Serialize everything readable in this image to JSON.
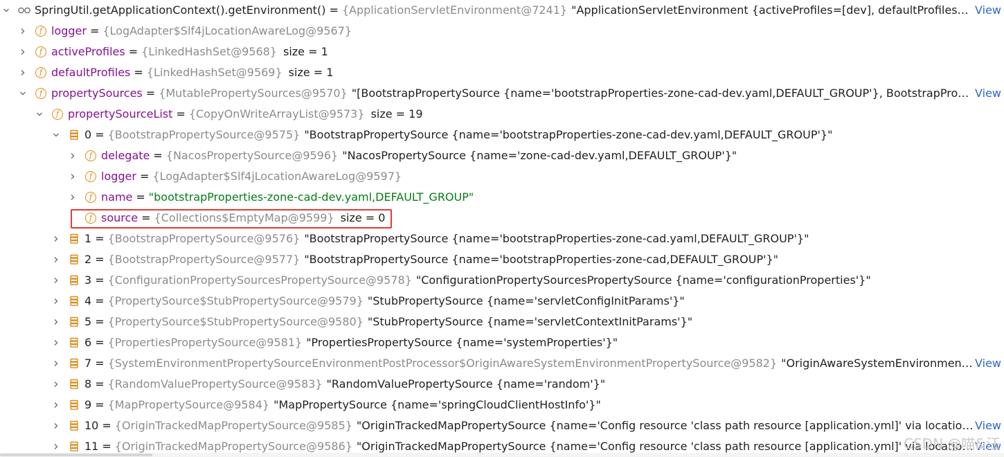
{
  "rows": [
    {
      "depth": 0,
      "chev": "down",
      "icon": "watch",
      "name": "SpringUtil.getApplicationContext().getEnvironment()",
      "name_color": "black",
      "ref": "{ApplicationServletEnvironment@7241}",
      "val": "\"ApplicationServletEnvironment {activeProfiles=[dev], defaultProfiles=[default], propertySources=[BootstrapPropertySource {name='bootstrapProperties-zone-cad-dev.yaml,DEFAULT_GROUP'}]}\"",
      "view": "View"
    },
    {
      "depth": 1,
      "chev": "right",
      "icon": "field",
      "name": "logger",
      "ref": "{LogAdapter$Slf4jLocationAwareLog@9567}"
    },
    {
      "depth": 1,
      "chev": "right",
      "icon": "field",
      "name": "activeProfiles",
      "ref": "{LinkedHashSet@9568}",
      "size": "size = 1"
    },
    {
      "depth": 1,
      "chev": "right",
      "icon": "field",
      "name": "defaultProfiles",
      "ref": "{LinkedHashSet@9569}",
      "size": "size = 1"
    },
    {
      "depth": 1,
      "chev": "down",
      "icon": "field",
      "name": "propertySources",
      "ref": "{MutablePropertySources@9570}",
      "val": "\"[BootstrapPropertySource {name='bootstrapProperties-zone-cad-dev.yaml,DEFAULT_GROUP'}, BootstrapPropertySource {name='bootstrapProperties-zone-cad.yaml,DEFAULT_GROUP'}]\"",
      "view": "View"
    },
    {
      "depth": 2,
      "chev": "down",
      "icon": "field",
      "name": "propertySourceList",
      "ref": "{CopyOnWriteArrayList@9573}",
      "size": "size = 19"
    },
    {
      "depth": 3,
      "chev": "down",
      "icon": "array",
      "name": "0",
      "name_color": "black",
      "ref": "{BootstrapPropertySource@9575}",
      "val": "\"BootstrapPropertySource {name='bootstrapProperties-zone-cad-dev.yaml,DEFAULT_GROUP'}\""
    },
    {
      "depth": 4,
      "chev": "right",
      "icon": "field",
      "name": "delegate",
      "ref": "{NacosPropertySource@9596}",
      "val": "\"NacosPropertySource {name='zone-cad-dev.yaml,DEFAULT_GROUP'}\""
    },
    {
      "depth": 4,
      "chev": "right",
      "icon": "field",
      "name": "logger",
      "ref": "{LogAdapter$Slf4jLocationAwareLog@9597}"
    },
    {
      "depth": 4,
      "chev": "right",
      "icon": "field",
      "name": "name",
      "green": "\"bootstrapProperties-zone-cad-dev.yaml,DEFAULT_GROUP\""
    },
    {
      "depth": 4,
      "chev": "none",
      "icon": "field",
      "name": "source",
      "ref": "{Collections$EmptyMap@9599}",
      "size": "size = 0"
    },
    {
      "depth": 3,
      "chev": "right",
      "icon": "array",
      "name": "1",
      "name_color": "black",
      "ref": "{BootstrapPropertySource@9576}",
      "val": "\"BootstrapPropertySource {name='bootstrapProperties-zone-cad.yaml,DEFAULT_GROUP'}\""
    },
    {
      "depth": 3,
      "chev": "right",
      "icon": "array",
      "name": "2",
      "name_color": "black",
      "ref": "{BootstrapPropertySource@9577}",
      "val": "\"BootstrapPropertySource {name='bootstrapProperties-zone-cad,DEFAULT_GROUP'}\""
    },
    {
      "depth": 3,
      "chev": "right",
      "icon": "array",
      "name": "3",
      "name_color": "black",
      "ref": "{ConfigurationPropertySourcesPropertySource@9578}",
      "val": "\"ConfigurationPropertySourcesPropertySource {name='configurationProperties'}\""
    },
    {
      "depth": 3,
      "chev": "right",
      "icon": "array",
      "name": "4",
      "name_color": "black",
      "ref": "{PropertySource$StubPropertySource@9579}",
      "val": "\"StubPropertySource {name='servletConfigInitParams'}\""
    },
    {
      "depth": 3,
      "chev": "right",
      "icon": "array",
      "name": "5",
      "name_color": "black",
      "ref": "{PropertySource$StubPropertySource@9580}",
      "val": "\"StubPropertySource {name='servletContextInitParams'}\""
    },
    {
      "depth": 3,
      "chev": "right",
      "icon": "array",
      "name": "6",
      "name_color": "black",
      "ref": "{PropertiesPropertySource@9581}",
      "val": "\"PropertiesPropertySource {name='systemProperties'}\""
    },
    {
      "depth": 3,
      "chev": "right",
      "icon": "array",
      "name": "7",
      "name_color": "black",
      "ref": "{SystemEnvironmentPropertySourceEnvironmentPostProcessor$OriginAwareSystemEnvironmentPropertySource@9582}",
      "val": "\"OriginAwareSystemEnvironmentPropertySource {name='systemEnvironment'}\"",
      "view": "View"
    },
    {
      "depth": 3,
      "chev": "right",
      "icon": "array",
      "name": "8",
      "name_color": "black",
      "ref": "{RandomValuePropertySource@9583}",
      "val": "\"RandomValuePropertySource {name='random'}\""
    },
    {
      "depth": 3,
      "chev": "right",
      "icon": "array",
      "name": "9",
      "name_color": "black",
      "ref": "{MapPropertySource@9584}",
      "val": "\"MapPropertySource {name='springCloudClientHostInfo'}\""
    },
    {
      "depth": 3,
      "chev": "right",
      "icon": "array",
      "name": "10",
      "name_color": "black",
      "ref": "{OriginTrackedMapPropertySource@9585}",
      "val": "\"OriginTrackedMapPropertySource {name='Config resource 'class path resource [application.yml]' via location 'optional:classpath:/''}\"",
      "view": "View"
    },
    {
      "depth": 3,
      "chev": "right",
      "icon": "array",
      "name": "11",
      "name_color": "black",
      "ref": "{OriginTrackedMapPropertySource@9586}",
      "val": "\"OriginTrackedMapPropertySource {name='Config resource 'class path resource [application.yml]' via location 'optional:classpath:/''}\"",
      "view": "View"
    }
  ],
  "watermark": "CSDN @喵&汪",
  "colors": {
    "field_icon": "#e08a14",
    "array_icon": "#d98b1a",
    "ref": "#8c8c8c",
    "name": "#871094",
    "green": "#067d17",
    "link": "#2f65ca",
    "highlight": "#e53935"
  }
}
